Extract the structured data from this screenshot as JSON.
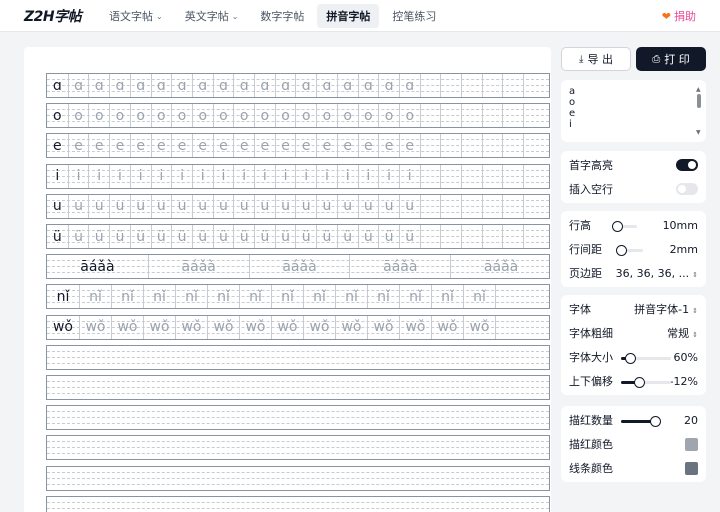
{
  "logo": "Z2H字帖",
  "nav": [
    {
      "label": "语文字帖",
      "dropdown": true
    },
    {
      "label": "英文字帖",
      "dropdown": true
    },
    {
      "label": "数字字帖",
      "dropdown": false
    },
    {
      "label": "拼音字帖",
      "dropdown": false,
      "active": true
    },
    {
      "label": "控笔练习",
      "dropdown": false
    }
  ],
  "donate": "捐助",
  "actions": {
    "export": "导 出",
    "print": "打 印"
  },
  "input_lines": [
    "a",
    "o",
    "e",
    "i"
  ],
  "rows": [
    {
      "first": "ɑ",
      "trace": "ɑ",
      "count": 17
    },
    {
      "first": "o",
      "trace": "o",
      "count": 17
    },
    {
      "first": "e",
      "trace": "e",
      "count": 17
    },
    {
      "first": "i",
      "trace": "i",
      "count": 17
    },
    {
      "first": "u",
      "trace": "u",
      "count": 17
    },
    {
      "first": "ü",
      "trace": "ü",
      "count": 17
    },
    {
      "tones": [
        "āáǎà",
        "āáǎà",
        "āáǎà",
        "āáǎà",
        "āáǎà"
      ]
    },
    {
      "first": "nǐ",
      "trace": "nǐ",
      "count": 13
    },
    {
      "first": "wǒ",
      "trace": "wǒ",
      "count": 13
    }
  ],
  "settings": {
    "highlight_first": {
      "label": "首字高亮",
      "on": true
    },
    "insert_blank": {
      "label": "插入空行",
      "on": false
    },
    "row_height": {
      "label": "行高",
      "value": "10mm",
      "level": 0.18
    },
    "row_gap": {
      "label": "行间距",
      "value": "2mm",
      "level": 0.1
    },
    "margin": {
      "label": "页边距",
      "value": "36, 36, 36, ..."
    },
    "font": {
      "label": "字体",
      "value": "拼音字体-1"
    },
    "weight": {
      "label": "字体粗细",
      "value": "常规"
    },
    "size": {
      "label": "字体大小",
      "value": "60%",
      "level": 0.18
    },
    "offset": {
      "label": "上下偏移",
      "value": "-12%",
      "level": 0.36
    },
    "trace_count": {
      "label": "描红数量",
      "value": "20",
      "level": 0.9
    },
    "trace_color": {
      "label": "描红颜色",
      "color": "#a0a6ae"
    },
    "line_color": {
      "label": "线条颜色",
      "color": "#6b7380"
    }
  }
}
